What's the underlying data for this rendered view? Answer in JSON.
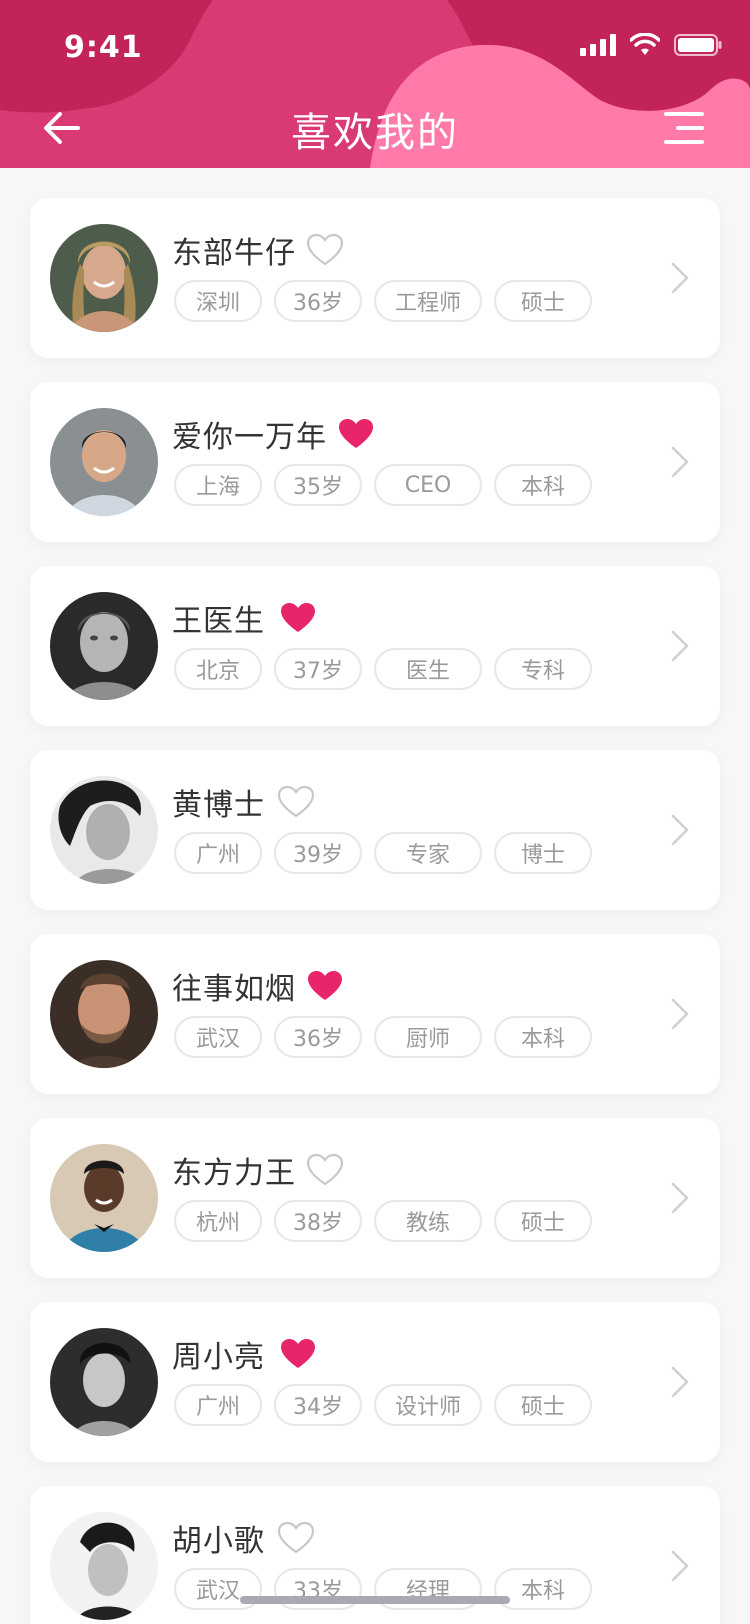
{
  "status_bar": {
    "time": "9:41"
  },
  "header": {
    "title": "喜欢我的",
    "back_icon": "arrow-left-icon",
    "menu_icon": "menu-icon"
  },
  "colors": {
    "header_primary": "#c22358",
    "header_wave": "#d93a73",
    "header_light": "#ff7aa8",
    "heart_filled": "#e8256b",
    "heart_outline": "#c8c8cc",
    "tag_border": "#e7e7ea",
    "tag_text": "#9a9a9a"
  },
  "matches": [
    {
      "name": "东部牛仔",
      "liked": false,
      "tags": [
        "深圳",
        "36岁",
        "工程师",
        "硕士"
      ]
    },
    {
      "name": "爱你一万年",
      "liked": true,
      "tags": [
        "上海",
        "35岁",
        "CEO",
        "本科"
      ]
    },
    {
      "name": "王医生",
      "liked": true,
      "tags": [
        "北京",
        "37岁",
        "医生",
        "专科"
      ]
    },
    {
      "name": "黄博士",
      "liked": false,
      "tags": [
        "广州",
        "39岁",
        "专家",
        "博士"
      ]
    },
    {
      "name": "往事如烟",
      "liked": true,
      "tags": [
        "武汉",
        "36岁",
        "厨师",
        "本科"
      ]
    },
    {
      "name": "东方力王",
      "liked": false,
      "tags": [
        "杭州",
        "38岁",
        "教练",
        "硕士"
      ]
    },
    {
      "name": "周小亮",
      "liked": true,
      "tags": [
        "广州",
        "34岁",
        "设计师",
        "硕士"
      ]
    },
    {
      "name": "胡小歌",
      "liked": false,
      "tags": [
        "武汉",
        "33岁",
        "经理",
        "本科"
      ]
    }
  ]
}
